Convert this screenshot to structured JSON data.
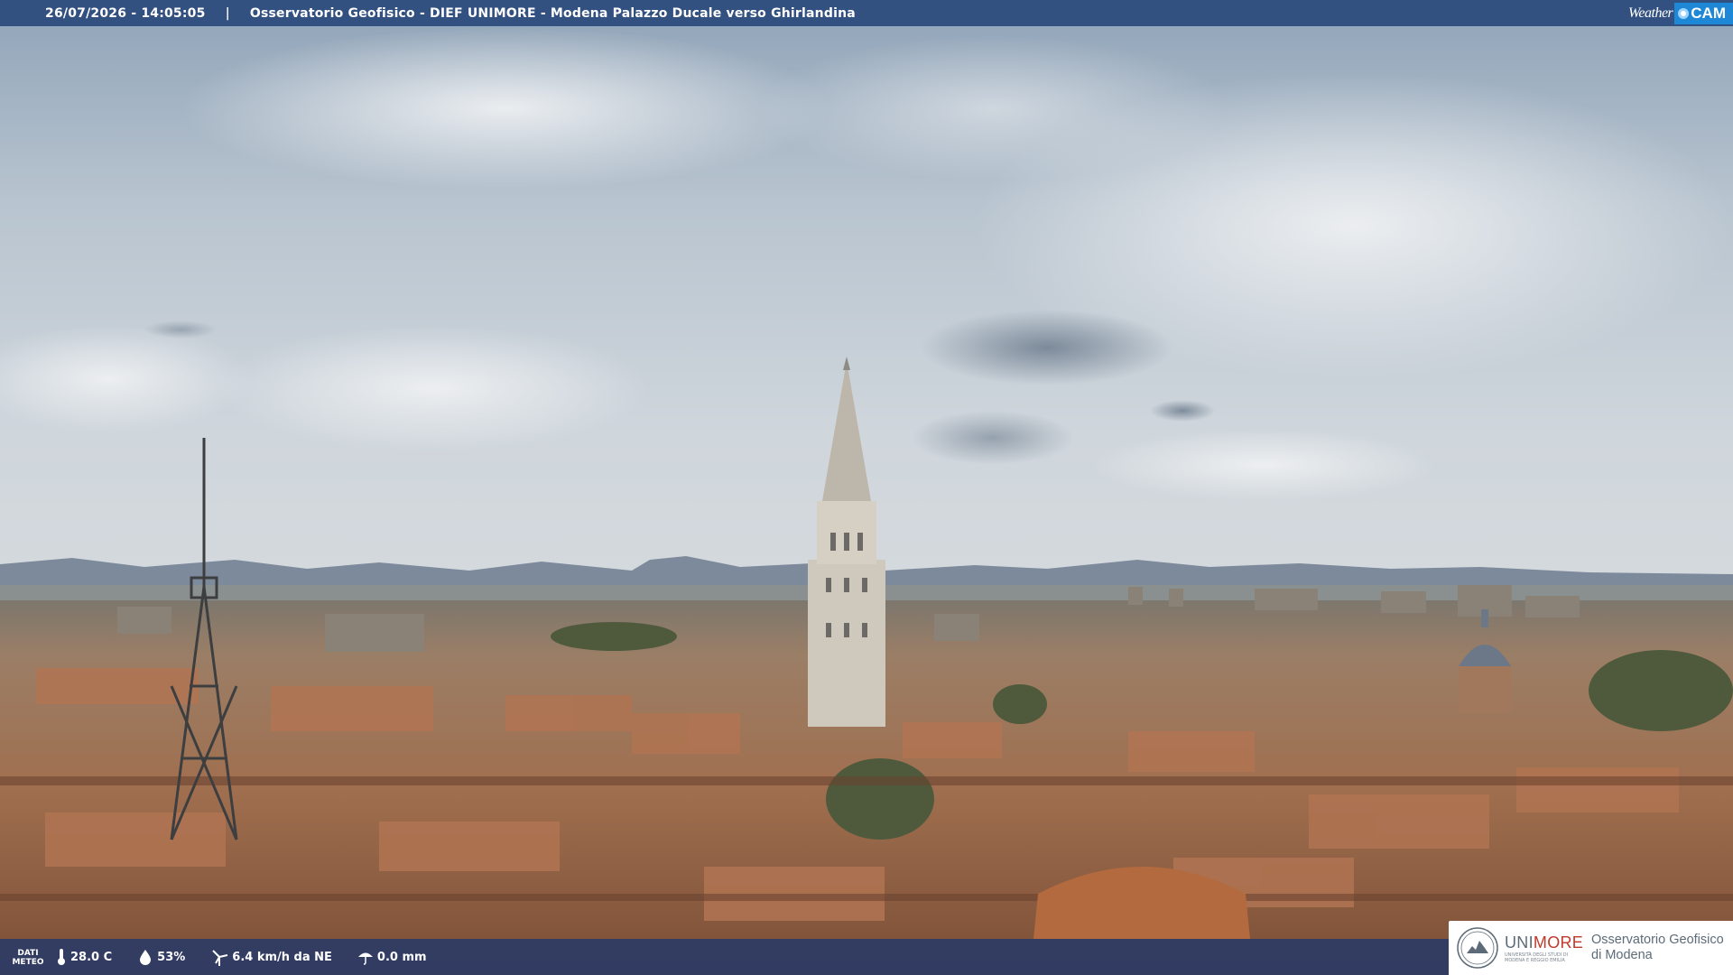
{
  "overlay": {
    "datetime": "26/07/2026 - 14:05:05",
    "separator": "|",
    "location": "Osservatorio Geofisico - DIEF UNIMORE - Modena Palazzo Ducale verso Ghirlandina",
    "brand_weather": "Weather",
    "brand_cam": "CAM"
  },
  "weather": {
    "label_line1": "DATI",
    "label_line2": "METEO",
    "temperature": "28.0 C",
    "humidity": "53%",
    "wind": "6.4 km/h da NE",
    "rain": "0.0 mm"
  },
  "logo": {
    "uni_prefix": "UNI",
    "uni_suffix": "MORE",
    "uni_sub": "Università degli studi di Modena e Reggio Emilia",
    "observatory_line1": "Osservatorio Geofisico",
    "observatory_line2": "di Modena"
  },
  "colors": {
    "topbar": "#26467a",
    "brand_cam": "#1f88d6",
    "unimore_red": "#c0392b"
  }
}
